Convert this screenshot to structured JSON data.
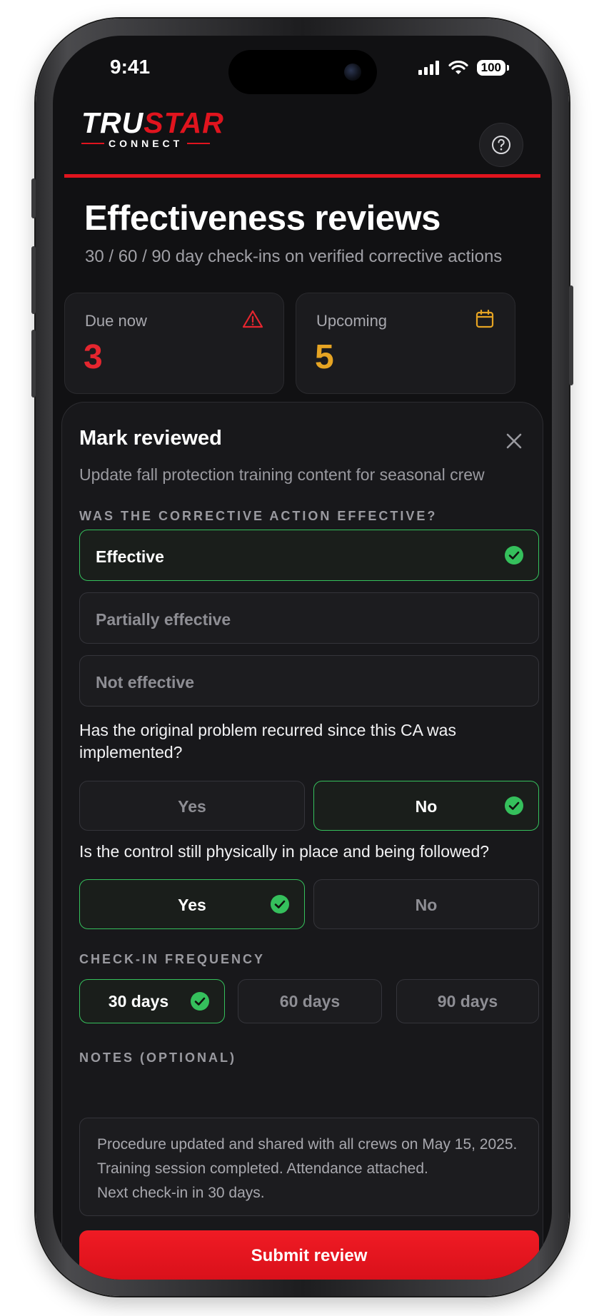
{
  "status_bar": {
    "time": "9:41",
    "battery": "100"
  },
  "brand": {
    "logo_tru": "TRU",
    "logo_star": "STAR",
    "logo_sub": "CONNECT",
    "accent_color": "#e0141e"
  },
  "header": {
    "help_icon": "question-circle-icon"
  },
  "page": {
    "title": "Effectiveness reviews",
    "subtitle": "30 / 60 / 90 day check-ins on verified corrective actions"
  },
  "stats": {
    "due": {
      "label": "Due now",
      "value": "3",
      "color": "#e5262f",
      "icon": "warning-triangle-icon"
    },
    "upcoming": {
      "label": "Upcoming",
      "value": "5",
      "color": "#e6a423",
      "icon": "calendar-icon"
    }
  },
  "sheet": {
    "title": "Mark reviewed",
    "subtitle": "Update fall protection training content for seasonal crew",
    "close_icon": "close-icon",
    "effectiveness": {
      "label": "WAS THE CORRECTIVE ACTION EFFECTIVE?",
      "options": [
        {
          "label": "Effective",
          "selected": true
        },
        {
          "label": "Partially effective",
          "selected": false
        },
        {
          "label": "Not effective",
          "selected": false
        }
      ]
    },
    "recurred": {
      "question": "Has the original problem recurred since this CA was implemented?",
      "yes": "Yes",
      "no": "No",
      "selected": "No"
    },
    "control": {
      "question": "Is the control still physically in place and being followed?",
      "yes": "Yes",
      "no": "No",
      "selected": "Yes"
    },
    "frequency": {
      "label": "CHECK-IN FREQUENCY",
      "options": [
        "30 days",
        "60 days",
        "90 days"
      ],
      "selected": "30 days"
    },
    "notes": {
      "label": "NOTES (OPTIONAL)",
      "value": "Procedure updated and shared with all crews on May 15, 2025.\nTraining session completed. Attendance attached.\nNext check-in in 30 days."
    },
    "submit_label": "Submit review",
    "selected_color": "#35c05c"
  }
}
